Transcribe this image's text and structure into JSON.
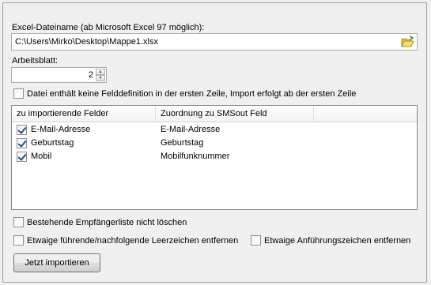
{
  "file": {
    "label": "Excel-Dateiname (ab Microsoft Excel 97 möglich):",
    "value": "C:\\Users\\Mirko\\Desktop\\Mappe1.xlsx"
  },
  "sheet": {
    "label": "Arbeitsblatt:",
    "value": "2"
  },
  "options": {
    "no_header_label": "Datei enthält keine Felddefinition in der ersten Zeile, Import erfolgt ab der ersten Zeile",
    "keep_list_label": "Bestehende Empfängerliste nicht löschen",
    "trim_spaces_label": "Etwaige führende/nachfolgende Leerzeichen entfernen",
    "remove_quotes_label": "Etwaige Anführungszeichen entfernen"
  },
  "fields": {
    "columns": [
      "zu importierende Felder",
      "Zuordnung zu SMSout Feld"
    ],
    "rows": [
      {
        "field": "E-Mail-Adresse",
        "mapping": "E-Mail-Adresse",
        "checked": true
      },
      {
        "field": "Geburtstag",
        "mapping": "Geburtstag",
        "checked": true
      },
      {
        "field": "Mobil",
        "mapping": "Mobilfunknummer",
        "checked": true
      }
    ]
  },
  "import_button": "Jetzt importieren"
}
